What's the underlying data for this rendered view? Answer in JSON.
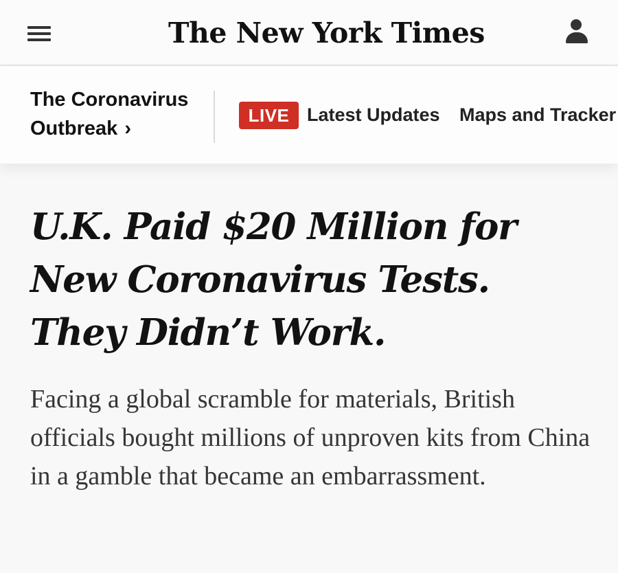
{
  "header": {
    "logo_text": "The New York Times",
    "menu_icon": "hamburger-menu-icon",
    "account_icon": "account-user-icon"
  },
  "section_nav": {
    "section_title": "The Coronavirus Outbreak",
    "section_chevron": "›",
    "live_label": "LIVE",
    "latest_label": "Latest Updates",
    "maps_label": "Maps and Tracker",
    "live_color": "#cf2f24"
  },
  "article": {
    "headline": "U.K. Paid $20 Million for New Coronavirus Tests. They Didn’t Work.",
    "summary": "Facing a global scramble for materials, British officials bought millions of unproven kits from China in a gamble that became an embarrassment."
  }
}
